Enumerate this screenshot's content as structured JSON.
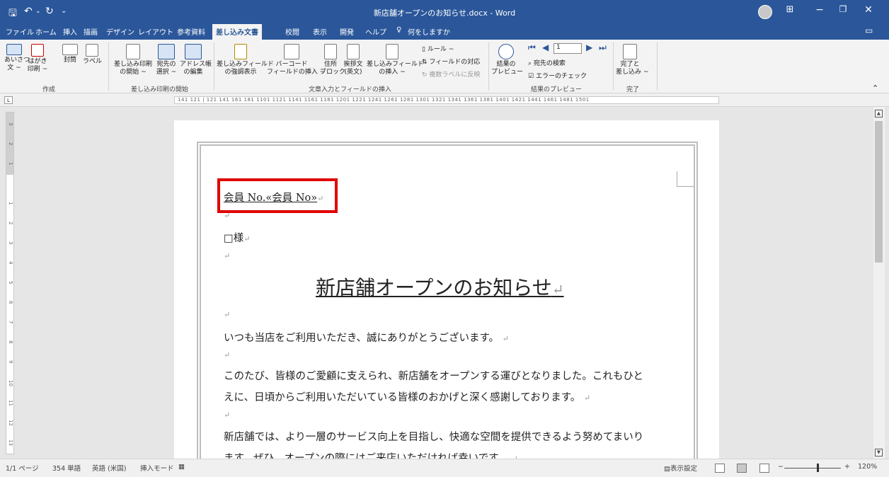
{
  "window": {
    "title": "新店舗オープンのお知らせ.docx  -  Word",
    "qa_save_icon": "save-icon",
    "qa_undo_icon": "undo-icon",
    "qa_redo_icon": "redo-icon"
  },
  "tabs": [
    "ファイル",
    "ホーム",
    "挿入",
    "描画",
    "デザイン",
    "レイアウト",
    "参考資料",
    "差し込み文書",
    "校閲",
    "表示",
    "開発",
    "ヘルプ",
    "何をしますか"
  ],
  "tabs_active": "差し込み文書",
  "ribbon": {
    "create": {
      "greeting": "あいさつ\n文 ~",
      "postcard": "はがき\n印刷 ~",
      "envelope": "封筒",
      "label": "ラベル",
      "group": "作成"
    },
    "start": {
      "start_merge": "差し込み印刷\nの開始 ~",
      "select_recipients": "宛先の\n選択 ~",
      "edit_list": "アドレス帳\nの編集",
      "group": "差し込み印刷の開始"
    },
    "fields": {
      "highlight": "差し込みフィールド\nの強調表示",
      "barcode": "バーコード\nフィールドの挿入 ~",
      "address": "住所\nブロック",
      "greeting_line": "挨拶文\n(英文)",
      "insert_field": "差し込みフィールド\nの挿入 ~",
      "rules": "ルール ~",
      "match_fields": "フィールドの対応",
      "update_labels": "複数ラベルに反映",
      "group": "文章入力とフィールドの挿入"
    },
    "preview": {
      "preview_results": "結果の\nプレビュー",
      "record": "1",
      "find_recipient": "宛先の検索",
      "check_errors": "エラーのチェック",
      "group": "結果のプレビュー"
    },
    "finish": {
      "finish_merge": "完了と\n差し込み ~",
      "group": "完了"
    }
  },
  "ruler": {
    "tab_selector": "L",
    "h_numbers": "141  121   |   121  141  161  181  1101  1121  1141  1161  1181  1201  1221  1241  1261  1281  1301  1321  1341  1361  1381  1401  1421  1441  1461  1481  1501",
    "v_numbers": [
      "3",
      "2",
      "1",
      "1",
      "2",
      "3",
      "4",
      "5",
      "6",
      "7",
      "8",
      "9",
      "10",
      "11",
      "12",
      "13"
    ]
  },
  "document": {
    "member_line": "会員 No.«会員 No»",
    "recipient": "□様",
    "heading": "新店舗オープンのお知らせ",
    "para1": "いつも当店をご利用いただき、誠にありがとうございます。",
    "para2_line1": "このたび、皆様のご愛顧に支えられ、新店舗をオープンする運びとなりました。これもひと",
    "para2_line2": "えに、日頃からご利用いただいている皆様のおかげと深く感謝しております。",
    "para3_line1": "新店舗では、より一層のサービス向上を目指し、快適な空間を提供できるよう努めてまいり",
    "para3_line2": "ます。ぜひ、オープンの際にはご来店いただければ幸いです。",
    "paragraph_mark": "↵"
  },
  "status": {
    "page": "1/1 ページ",
    "words": "354 単語",
    "language": "英語 (米国)",
    "mode": "挿入モード",
    "display_settings": "表示設定",
    "zoom": "120%",
    "zoom_minus": "−",
    "zoom_plus": "+"
  },
  "colors": {
    "accent": "#2b579a",
    "highlight_box": "#e00000"
  }
}
